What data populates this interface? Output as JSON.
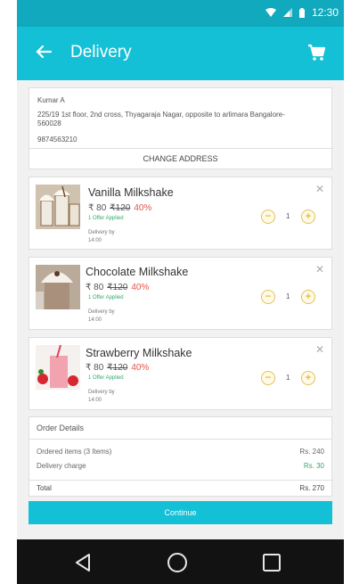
{
  "status_bar": {
    "time": "12:30"
  },
  "header": {
    "title": "Delivery"
  },
  "address": {
    "name": "Kumar A",
    "line": "225/19 1st floor, 2nd cross,  Thyagaraja Nagar, opposite to arlimara Bangalore-560028",
    "phone": "9874563210",
    "change_label": "CHANGE ADDRESS"
  },
  "items": [
    {
      "name": "Vanilla Milkshake",
      "price": "₹ 80",
      "original_price": "₹120",
      "discount": "40%",
      "offer": "1 Offer Applied",
      "delivery_label": "Delivery by",
      "delivery_time": "14:00",
      "quantity": "1"
    },
    {
      "name": "Chocolate Milkshake",
      "price": "₹ 80",
      "original_price": "₹120",
      "discount": "40%",
      "offer": "1 Offer Applied",
      "delivery_label": "Delivery by",
      "delivery_time": "14:00",
      "quantity": "1"
    },
    {
      "name": "Strawberry Milkshake",
      "price": "₹ 80",
      "original_price": "₹120",
      "discount": "40%",
      "offer": "1 Offer Applied",
      "delivery_label": "Delivery by",
      "delivery_time": "14:00",
      "quantity": "1"
    }
  ],
  "order": {
    "title": "Order Details",
    "ordered_label": "Ordered items (3 Items)",
    "ordered_value": "Rs. 240",
    "delivery_label": "Delivery charge",
    "delivery_value": "Rs. 30",
    "total_label": "Total",
    "total_value": "Rs. 270"
  },
  "continue_label": "Continue",
  "colors": {
    "primary": "#14c0d6",
    "status_bar": "#10a9bd",
    "discount": "#e2564a",
    "offer": "#35a86a"
  },
  "icons": [
    "wifi-icon",
    "signal-icon",
    "battery-icon",
    "back-arrow-icon",
    "cart-icon",
    "close-icon",
    "minus-icon",
    "plus-icon",
    "nav-back-icon",
    "nav-home-icon",
    "nav-recents-icon"
  ]
}
